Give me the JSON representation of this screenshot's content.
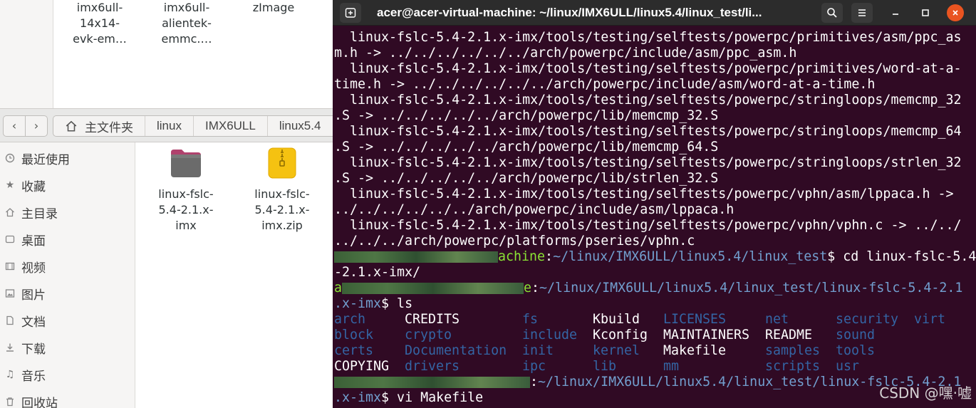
{
  "files_window": {
    "top_files": [
      {
        "lines": [
          "imx6ull-",
          "14x14-",
          "evk-em…"
        ]
      },
      {
        "lines": [
          "imx6ull-",
          "alientek-",
          "emmc.…"
        ]
      },
      {
        "lines": [
          "zImage"
        ]
      }
    ],
    "toolbar": {
      "back_glyph": "‹",
      "forward_glyph": "›",
      "breadcrumbs": [
        "主文件夹",
        "linux",
        "IMX6ULL",
        "linux5.4"
      ]
    },
    "sidebar": {
      "items": [
        {
          "label": "最近使用",
          "icon": "clock-icon"
        },
        {
          "label": "收藏",
          "icon": "star-icon"
        },
        {
          "label": "主目录",
          "icon": "home-icon"
        },
        {
          "label": "桌面",
          "icon": "desktop-icon"
        },
        {
          "label": "视频",
          "icon": "video-icon"
        },
        {
          "label": "图片",
          "icon": "image-icon"
        },
        {
          "label": "文档",
          "icon": "document-icon"
        },
        {
          "label": "下载",
          "icon": "download-icon"
        },
        {
          "label": "音乐",
          "icon": "music-icon"
        },
        {
          "label": "回收站",
          "icon": "trash-icon"
        }
      ]
    },
    "main_files": [
      {
        "lines": [
          "linux-fslc-",
          "5.4-2.1.x-",
          "imx"
        ],
        "icon": "folder-icon"
      },
      {
        "lines": [
          "linux-fslc-",
          "5.4-2.1.x-",
          "imx.zip"
        ],
        "icon": "zip-archive-icon"
      }
    ]
  },
  "terminal": {
    "title": "acer@acer-virtual-machine: ~/linux/IMX6ULL/linux5.4/linux_test/li...",
    "colors": {
      "background": "#300a24",
      "prompt_user": "#8ae234",
      "prompt_path": "#729fcf",
      "ls_dir": "#3465a4"
    },
    "output_lines": [
      "  linux-fslc-5.4-2.1.x-imx/tools/testing/selftests/powerpc/primitives/asm/ppc_as",
      "m.h -> ../../../../../../arch/powerpc/include/asm/ppc_asm.h",
      "  linux-fslc-5.4-2.1.x-imx/tools/testing/selftests/powerpc/primitives/word-at-a-",
      "time.h -> ../../../../../../arch/powerpc/include/asm/word-at-a-time.h",
      "  linux-fslc-5.4-2.1.x-imx/tools/testing/selftests/powerpc/stringloops/memcmp_32",
      ".S -> ../../../../../arch/powerpc/lib/memcmp_32.S",
      "  linux-fslc-5.4-2.1.x-imx/tools/testing/selftests/powerpc/stringloops/memcmp_64",
      ".S -> ../../../../../arch/powerpc/lib/memcmp_64.S",
      "  linux-fslc-5.4-2.1.x-imx/tools/testing/selftests/powerpc/stringloops/strlen_32",
      ".S -> ../../../../../arch/powerpc/lib/strlen_32.S",
      "  linux-fslc-5.4-2.1.x-imx/tools/testing/selftests/powerpc/vphn/asm/lppaca.h ->",
      "../../../../../../arch/powerpc/include/asm/lppaca.h",
      "  linux-fslc-5.4-2.1.x-imx/tools/testing/selftests/powerpc/vphn/vphn.c -> ../../",
      "../../../arch/powerpc/platforms/pseries/vphn.c"
    ],
    "prompt1": {
      "host_visible": "achine",
      "colon": ":",
      "path": "~/linux/IMX6ULL/linux5.4/linux_test",
      "cmd": "$ cd linux-fslc-5.4",
      "cont": "-2.1.x-imx/"
    },
    "prompt2": {
      "user_first": "a",
      "host_visible": "e",
      "colon": ":",
      "path": "~/linux/IMX6ULL/linux5.4/linux_test/linux-fslc-5.4-2.1",
      "path_cont": ".x-imx",
      "cmd": "$ ls"
    },
    "ls_output": [
      {
        "name": "arch",
        "type": "dir"
      },
      {
        "name": "CREDITS",
        "type": "file"
      },
      {
        "name": "fs",
        "type": "dir"
      },
      {
        "name": "Kbuild",
        "type": "file"
      },
      {
        "name": "LICENSES",
        "type": "dir"
      },
      {
        "name": "net",
        "type": "dir"
      },
      {
        "name": "security",
        "type": "dir"
      },
      {
        "name": "virt",
        "type": "dir"
      },
      {
        "name": "block",
        "type": "dir"
      },
      {
        "name": "crypto",
        "type": "dir"
      },
      {
        "name": "include",
        "type": "dir"
      },
      {
        "name": "Kconfig",
        "type": "file"
      },
      {
        "name": "MAINTAINERS",
        "type": "file"
      },
      {
        "name": "README",
        "type": "file"
      },
      {
        "name": "sound",
        "type": "dir"
      },
      {
        "name": "certs",
        "type": "dir"
      },
      {
        "name": "Documentation",
        "type": "dir"
      },
      {
        "name": "init",
        "type": "dir"
      },
      {
        "name": "kernel",
        "type": "dir"
      },
      {
        "name": "Makefile",
        "type": "file"
      },
      {
        "name": "samples",
        "type": "dir"
      },
      {
        "name": "tools",
        "type": "dir"
      },
      {
        "name": "COPYING",
        "type": "file"
      },
      {
        "name": "drivers",
        "type": "dir"
      },
      {
        "name": "ipc",
        "type": "dir"
      },
      {
        "name": "lib",
        "type": "dir"
      },
      {
        "name": "mm",
        "type": "dir"
      },
      {
        "name": "scripts",
        "type": "dir"
      },
      {
        "name": "usr",
        "type": "dir"
      }
    ],
    "prompt3": {
      "colon": ":",
      "path": "~/linux/IMX6ULL/linux5.4/linux_test/linux-fslc-5.4-2.1",
      "path_cont": ".x-imx",
      "cmd": "$ vi Makefile"
    }
  },
  "watermark": "CSDN @嘿·嘘"
}
